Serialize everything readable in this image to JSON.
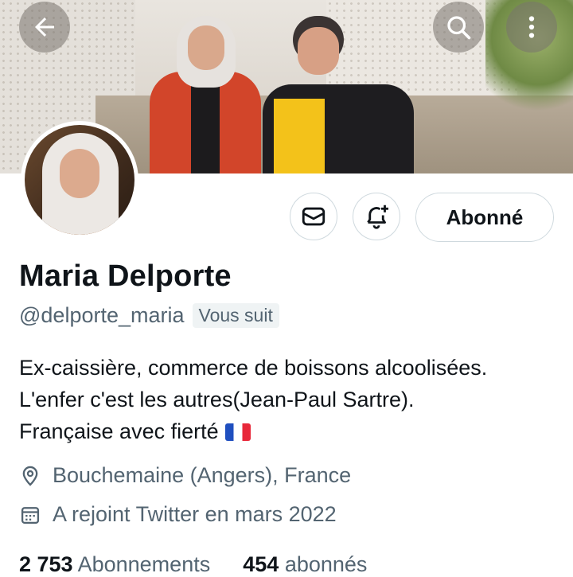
{
  "header": {
    "back_icon": "arrow-left-icon",
    "search_icon": "search-icon",
    "more_icon": "more-vertical-icon"
  },
  "actions": {
    "message_icon": "envelope-icon",
    "notify_icon": "bell-plus-icon",
    "follow_label": "Abonné"
  },
  "profile": {
    "name": "Maria Delporte",
    "handle": "@delporte_maria",
    "follows_you": "Vous suit",
    "bio_lines": [
      "Ex-caissière, commerce de boissons alcoolisées.",
      "L'enfer c'est les autres(Jean-Paul Sartre).",
      "Française avec fierté"
    ],
    "bio_emoji": "french-flag",
    "location": "Bouchemaine (Angers), France",
    "joined": "A rejoint Twitter en mars 2022"
  },
  "stats": {
    "following_count": "2 753",
    "following_label": "Abonnements",
    "followers_count": "454",
    "followers_label": "abonnés"
  },
  "colors": {
    "text_primary": "#0f1419",
    "text_secondary": "#536471",
    "border": "#cfd9de",
    "badge_bg": "#eff3f4"
  }
}
